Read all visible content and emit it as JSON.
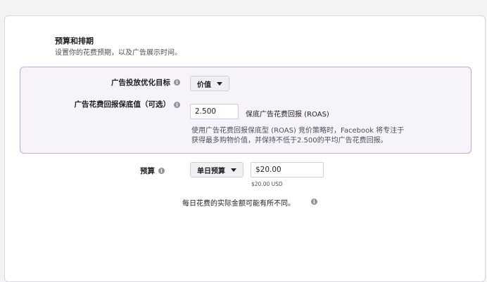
{
  "section": {
    "title": "预算和排期",
    "subtitle": "设置你的花费预期，以及广告展示时间。"
  },
  "optimization": {
    "goal_label": "广告投放优化目标",
    "goal_value": "价值",
    "roas_label": "广告花费回报保底值（可选）",
    "roas_value": "2.500",
    "roas_unit": "保底广告花费回报 (ROAS)",
    "help_line1": "使用广告花费回报保底型 (ROAS) 竞价策略时，Facebook 将专注于",
    "help_line2": "获得最多购物价值，并保持不低于2.500的平均广告花费回报。"
  },
  "budget": {
    "label": "预算",
    "type_value": "单日预算",
    "amount_value": "$20.00",
    "amount_currency": "$20.00 USD",
    "note": "每日花费的实际金额可能有所不同。"
  },
  "icons": {
    "info": "i"
  },
  "colors": {
    "highlight_border": "#c7a7e2",
    "highlight_bg": "#f7f3fb"
  }
}
